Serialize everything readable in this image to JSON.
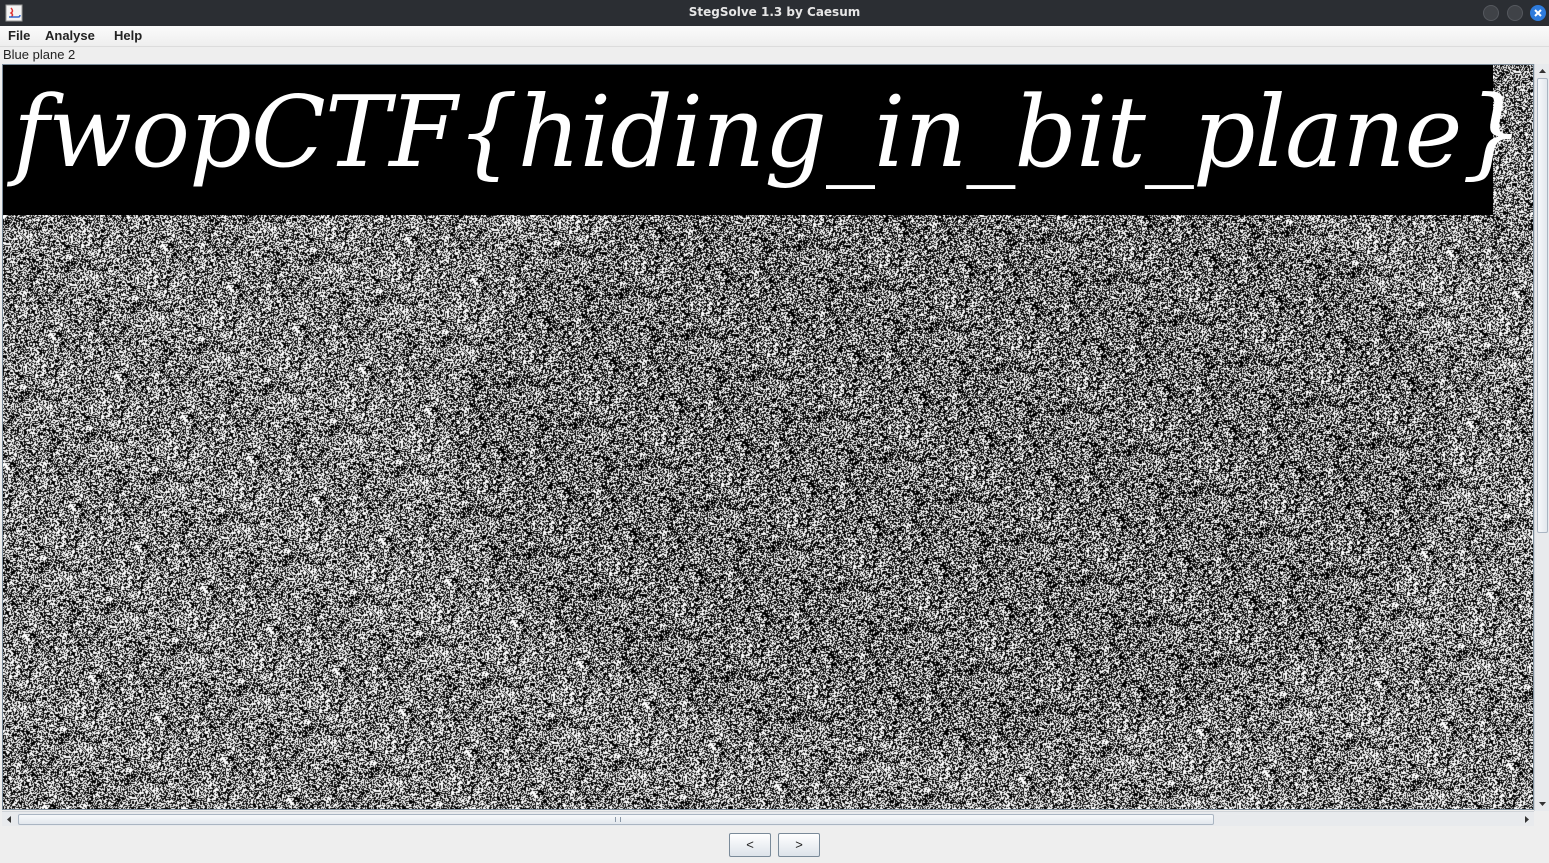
{
  "window": {
    "title": "StegSolve 1.3 by Caesum"
  },
  "menu": {
    "items": [
      "File",
      "Analyse",
      "Help"
    ]
  },
  "view": {
    "plane_label": "Blue plane 2",
    "hidden_text": "fwopCTF{hiding_in_bit_plane}"
  },
  "navigation": {
    "prev_label": "<",
    "next_label": ">"
  },
  "colors": {
    "titlebar": "#2b2e33",
    "close_button": "#2e7bdc",
    "banner": "#000000"
  }
}
